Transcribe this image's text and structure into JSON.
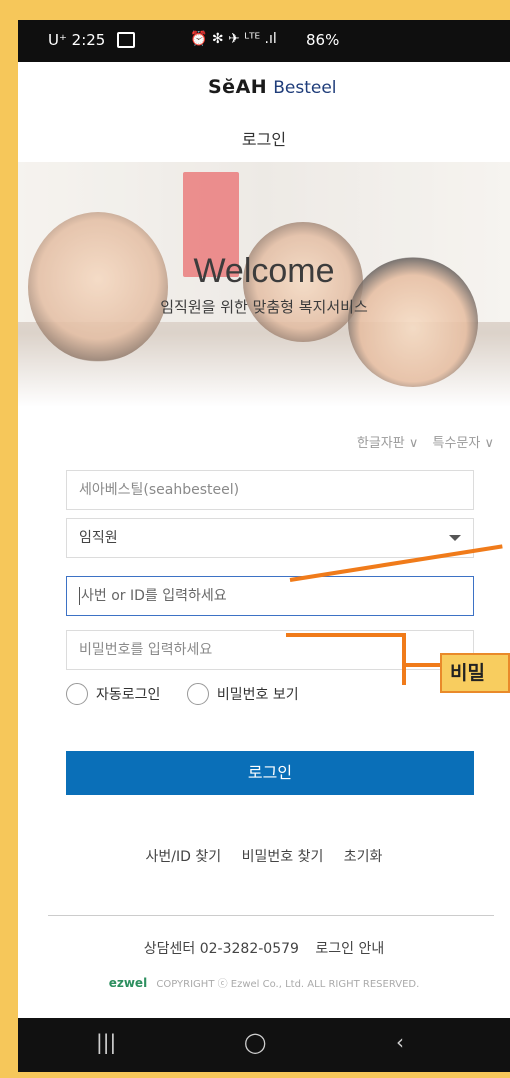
{
  "status_bar": {
    "time": "U⁺ 2:25",
    "icons": "🔔 ✱ ✈ ᴸᵀᴱ .∣ 86%",
    "battery": "86%"
  },
  "header": {
    "brand_bold": "SĕAH",
    "brand_light": "Besteel",
    "page_title": "로그인"
  },
  "hero": {
    "welcome": "Welcome",
    "subtitle": "임직원을 위한 맞춤형 복지서비스"
  },
  "keyboard_links": {
    "hangul": "한글자판 ∨",
    "special": "특수문자 ∨"
  },
  "form": {
    "company": "세아베스틸(seahbesteel)",
    "user_type": "임직원",
    "id_placeholder": "사번 or ID를 입력하세요",
    "password_placeholder": "비밀번호를 입력하세요",
    "auto_login": "자동로그인",
    "show_password": "비밀번호 보기",
    "login_button": "로그인"
  },
  "find_links": [
    "사번/ID 찾기",
    "비밀번호 찾기",
    "초기화"
  ],
  "footer": {
    "contact": "상담센터 02-3282-0579",
    "login_guide": "로그인 안내",
    "ezwel": "ezwel",
    "copyright": "COPYRIGHT ⓒ Ezwel Co., Ltd. ALL RIGHT RESERVED."
  },
  "annotation": {
    "label": "비밀"
  },
  "colors": {
    "primary": "#0a6fb8",
    "annotation": "#f07b1a",
    "annotation_bg": "#f8cd5f"
  }
}
